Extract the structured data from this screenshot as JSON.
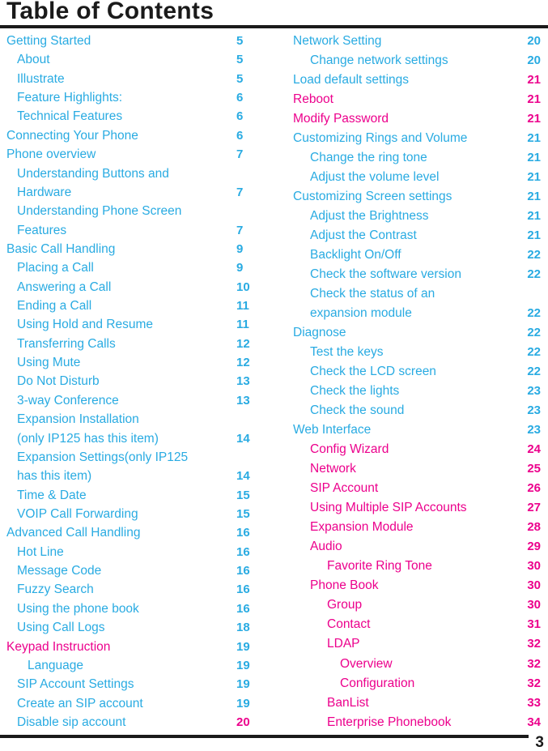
{
  "document": {
    "title": "Table of Contents",
    "folio": "3",
    "colors": {
      "cyan": "#29ABE2",
      "pink": "#EC008C",
      "rule": "#1a1a1a"
    }
  },
  "left_column": [
    {
      "label": "Getting Started",
      "page": "5",
      "level": 0,
      "color": "cyan",
      "page_color": "cyan"
    },
    {
      "label": "About",
      "page": "5",
      "level": 1,
      "color": "cyan",
      "page_color": "cyan"
    },
    {
      "label": "Illustrate",
      "page": "5",
      "level": 1,
      "color": "cyan",
      "page_color": "cyan"
    },
    {
      "label": "Feature Highlights:",
      "page": "6",
      "level": 1,
      "color": "cyan",
      "page_color": "cyan"
    },
    {
      "label": "Technical Features",
      "page": "6",
      "level": 1,
      "color": "cyan",
      "page_color": "cyan"
    },
    {
      "label": "Connecting Your Phone",
      "page": "6",
      "level": 0,
      "color": "cyan",
      "page_color": "cyan"
    },
    {
      "label": "Phone overview",
      "page": "7",
      "level": 0,
      "color": "cyan",
      "page_color": "cyan"
    },
    {
      "label": "Understanding Buttons and",
      "page": "",
      "level": 1,
      "color": "cyan",
      "page_color": "cyan"
    },
    {
      "label": "Hardware",
      "page": "7",
      "level": 1,
      "color": "cyan",
      "page_color": "cyan"
    },
    {
      "label": "Understanding Phone Screen",
      "page": "",
      "level": 1,
      "color": "cyan",
      "page_color": "cyan"
    },
    {
      "label": "Features",
      "page": "7",
      "level": 1,
      "color": "cyan",
      "page_color": "cyan"
    },
    {
      "label": "Basic Call Handling",
      "page": "9",
      "level": 0,
      "color": "cyan",
      "page_color": "cyan"
    },
    {
      "label": "Placing a Call",
      "page": "9",
      "level": 1,
      "color": "cyan",
      "page_color": "cyan"
    },
    {
      "label": "Answering a Call",
      "page": "10",
      "level": 1,
      "color": "cyan",
      "page_color": "cyan"
    },
    {
      "label": "Ending a Call",
      "page": "11",
      "level": 1,
      "color": "cyan",
      "page_color": "cyan"
    },
    {
      "label": "Using Hold and Resume",
      "page": "11",
      "level": 1,
      "color": "cyan",
      "page_color": "cyan"
    },
    {
      "label": "Transferring Calls",
      "page": "12",
      "level": 1,
      "color": "cyan",
      "page_color": "cyan"
    },
    {
      "label": "Using Mute",
      "page": "12",
      "level": 1,
      "color": "cyan",
      "page_color": "cyan"
    },
    {
      "label": "Do Not Disturb",
      "page": "13",
      "level": 1,
      "color": "cyan",
      "page_color": "cyan"
    },
    {
      "label": "3-way Conference",
      "page": "13",
      "level": 1,
      "color": "cyan",
      "page_color": "cyan"
    },
    {
      "label": "Expansion Installation",
      "page": "",
      "level": 1,
      "color": "cyan",
      "page_color": "cyan"
    },
    {
      "label": "(only IP125 has this item)",
      "page": "14",
      "level": 1,
      "color": "cyan",
      "page_color": "cyan"
    },
    {
      "label": "Expansion Settings(only IP125",
      "page": "",
      "level": 1,
      "color": "cyan",
      "page_color": "cyan"
    },
    {
      "label": "has this item)",
      "page": "14",
      "level": 1,
      "color": "cyan",
      "page_color": "cyan"
    },
    {
      "label": "Time & Date",
      "page": "15",
      "level": 1,
      "color": "cyan",
      "page_color": "cyan"
    },
    {
      "label": "VOIP Call Forwarding",
      "page": "15",
      "level": 1,
      "color": "cyan",
      "page_color": "cyan"
    },
    {
      "label": "Advanced Call Handling",
      "page": "16",
      "level": 0,
      "color": "cyan",
      "page_color": "cyan"
    },
    {
      "label": "Hot Line",
      "page": "16",
      "level": 1,
      "color": "cyan",
      "page_color": "cyan"
    },
    {
      "label": "Message Code",
      "page": "16",
      "level": 1,
      "color": "cyan",
      "page_color": "cyan"
    },
    {
      "label": "Fuzzy Search",
      "page": "16",
      "level": 1,
      "color": "cyan",
      "page_color": "cyan"
    },
    {
      "label": "Using the phone book",
      "page": "16",
      "level": 1,
      "color": "cyan",
      "page_color": "cyan"
    },
    {
      "label": "Using Call Logs",
      "page": "18",
      "level": 1,
      "color": "cyan",
      "page_color": "cyan"
    },
    {
      "label": "Keypad Instruction",
      "page": "19",
      "level": 0,
      "color": "pink",
      "page_color": "cyan"
    },
    {
      "label": "Language",
      "page": "19",
      "level": 2,
      "color": "cyan",
      "page_color": "cyan"
    },
    {
      "label": "SIP Account Settings",
      "page": "19",
      "level": 1,
      "color": "cyan",
      "page_color": "cyan"
    },
    {
      "label": "Create an SIP account",
      "page": "19",
      "level": 1,
      "color": "cyan",
      "page_color": "cyan"
    },
    {
      "label": "Disable sip account",
      "page": "20",
      "level": 1,
      "color": "cyan",
      "page_color": "pink"
    }
  ],
  "right_column": [
    {
      "label": "Network Setting",
      "page": "20",
      "level": 0,
      "color": "cyan",
      "page_color": "cyan"
    },
    {
      "label": "Change network settings",
      "page": "20",
      "level": 1,
      "color": "cyan",
      "page_color": "cyan"
    },
    {
      "label": "Load default settings",
      "page": "21",
      "level": 0,
      "color": "cyan",
      "page_color": "pink"
    },
    {
      "label": "Reboot",
      "page": "21",
      "level": 0,
      "color": "pink",
      "page_color": "pink"
    },
    {
      "label": "Modify Password",
      "page": "21",
      "level": 0,
      "color": "pink",
      "page_color": "pink"
    },
    {
      "label": "Customizing Rings and Volume",
      "page": "21",
      "level": 0,
      "color": "cyan",
      "page_color": "cyan"
    },
    {
      "label": "Change the ring tone",
      "page": "21",
      "level": 1,
      "color": "cyan",
      "page_color": "cyan"
    },
    {
      "label": "Adjust the volume level",
      "page": "21",
      "level": 1,
      "color": "cyan",
      "page_color": "cyan"
    },
    {
      "label": "Customizing Screen settings",
      "page": "21",
      "level": 0,
      "color": "cyan",
      "page_color": "cyan"
    },
    {
      "label": "Adjust the Brightness",
      "page": "21",
      "level": 1,
      "color": "cyan",
      "page_color": "cyan"
    },
    {
      "label": "Adjust the Contrast",
      "page": "21",
      "level": 1,
      "color": "cyan",
      "page_color": "cyan"
    },
    {
      "label": "Backlight On/Off",
      "page": "22",
      "level": 1,
      "color": "cyan",
      "page_color": "cyan"
    },
    {
      "label": "Check the software version",
      "page": "22",
      "level": 1,
      "color": "cyan",
      "page_color": "cyan"
    },
    {
      "label": "Check the status of an",
      "page": "",
      "level": 1,
      "color": "cyan",
      "page_color": "cyan"
    },
    {
      "label": "expansion module",
      "page": "22",
      "level": 1,
      "color": "cyan",
      "page_color": "cyan"
    },
    {
      "label": "Diagnose",
      "page": "22",
      "level": 0,
      "color": "cyan",
      "page_color": "cyan"
    },
    {
      "label": "Test the keys",
      "page": "22",
      "level": 1,
      "color": "cyan",
      "page_color": "cyan"
    },
    {
      "label": "Check the LCD screen",
      "page": "22",
      "level": 1,
      "color": "cyan",
      "page_color": "cyan"
    },
    {
      "label": "Check the lights",
      "page": "23",
      "level": 1,
      "color": "cyan",
      "page_color": "cyan"
    },
    {
      "label": "Check the sound",
      "page": "23",
      "level": 1,
      "color": "cyan",
      "page_color": "cyan"
    },
    {
      "label": "Web Interface",
      "page": "23",
      "level": 0,
      "color": "cyan",
      "page_color": "cyan"
    },
    {
      "label": "Config Wizard",
      "page": "24",
      "level": 1,
      "color": "pink",
      "page_color": "pink"
    },
    {
      "label": "Network",
      "page": "25",
      "level": 1,
      "color": "pink",
      "page_color": "pink"
    },
    {
      "label": "SIP Account",
      "page": "26",
      "level": 1,
      "color": "pink",
      "page_color": "pink"
    },
    {
      "label": "Using Multiple SIP Accounts",
      "page": "27",
      "level": 1,
      "color": "pink",
      "page_color": "pink"
    },
    {
      "label": "Expansion Module",
      "page": "28",
      "level": 1,
      "color": "pink",
      "page_color": "pink"
    },
    {
      "label": "Audio",
      "page": "29",
      "level": 1,
      "color": "pink",
      "page_color": "pink"
    },
    {
      "label": "Favorite Ring Tone",
      "page": "30",
      "level": 2,
      "color": "pink",
      "page_color": "pink"
    },
    {
      "label": "Phone Book",
      "page": "30",
      "level": 1,
      "color": "pink",
      "page_color": "pink"
    },
    {
      "label": "Group",
      "page": "30",
      "level": 2,
      "color": "pink",
      "page_color": "pink"
    },
    {
      "label": "Contact",
      "page": "31",
      "level": 2,
      "color": "pink",
      "page_color": "pink"
    },
    {
      "label": "LDAP",
      "page": "32",
      "level": 2,
      "color": "pink",
      "page_color": "pink"
    },
    {
      "label": "Overview",
      "page": "32",
      "level": 3,
      "color": "pink",
      "page_color": "pink"
    },
    {
      "label": "Configuration",
      "page": "32",
      "level": 3,
      "color": "pink",
      "page_color": "pink"
    },
    {
      "label": "BanList",
      "page": "33",
      "level": 2,
      "color": "pink",
      "page_color": "pink"
    },
    {
      "label": "Enterprise Phonebook",
      "page": "34",
      "level": 2,
      "color": "pink",
      "page_color": "pink"
    }
  ]
}
